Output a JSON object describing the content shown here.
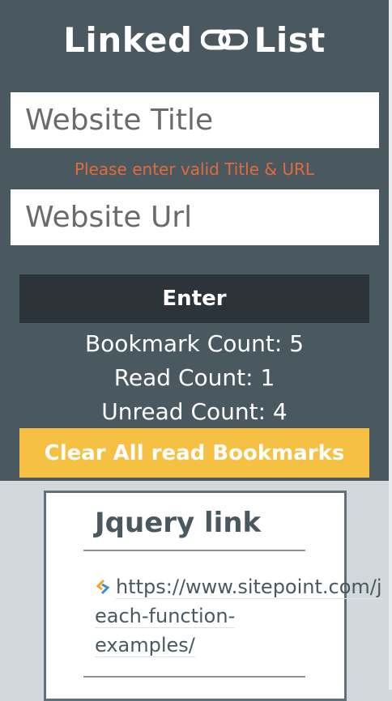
{
  "app": {
    "title_left": "Linked",
    "title_right": "List",
    "logo_icon": "chain-link-icon"
  },
  "form": {
    "title_placeholder": "Website Title",
    "url_placeholder": "Website Url",
    "error_message": "Please enter valid Title & URL",
    "enter_label": "Enter"
  },
  "stats": {
    "bookmark_count": "Bookmark Count: 5",
    "read_count": "Read Count: 1",
    "unread_count": "Unread Count: 4"
  },
  "clear_label": "Clear All read Bookmarks",
  "bookmarks": [
    {
      "title": "Jquery link",
      "url_lines": [
        "https://www.sitepoint.com/j",
        "each-function-",
        "examples/"
      ],
      "icon": "sitepoint-icon"
    }
  ],
  "colors": {
    "header_bg": "#4a5960",
    "field_bg": "#ffffff",
    "error": "#e36a3c",
    "enter_bg": "#2c3339",
    "clear_bg": "#f6c142",
    "page_bg": "#d3d8dc",
    "card_border": "#5e7079"
  }
}
